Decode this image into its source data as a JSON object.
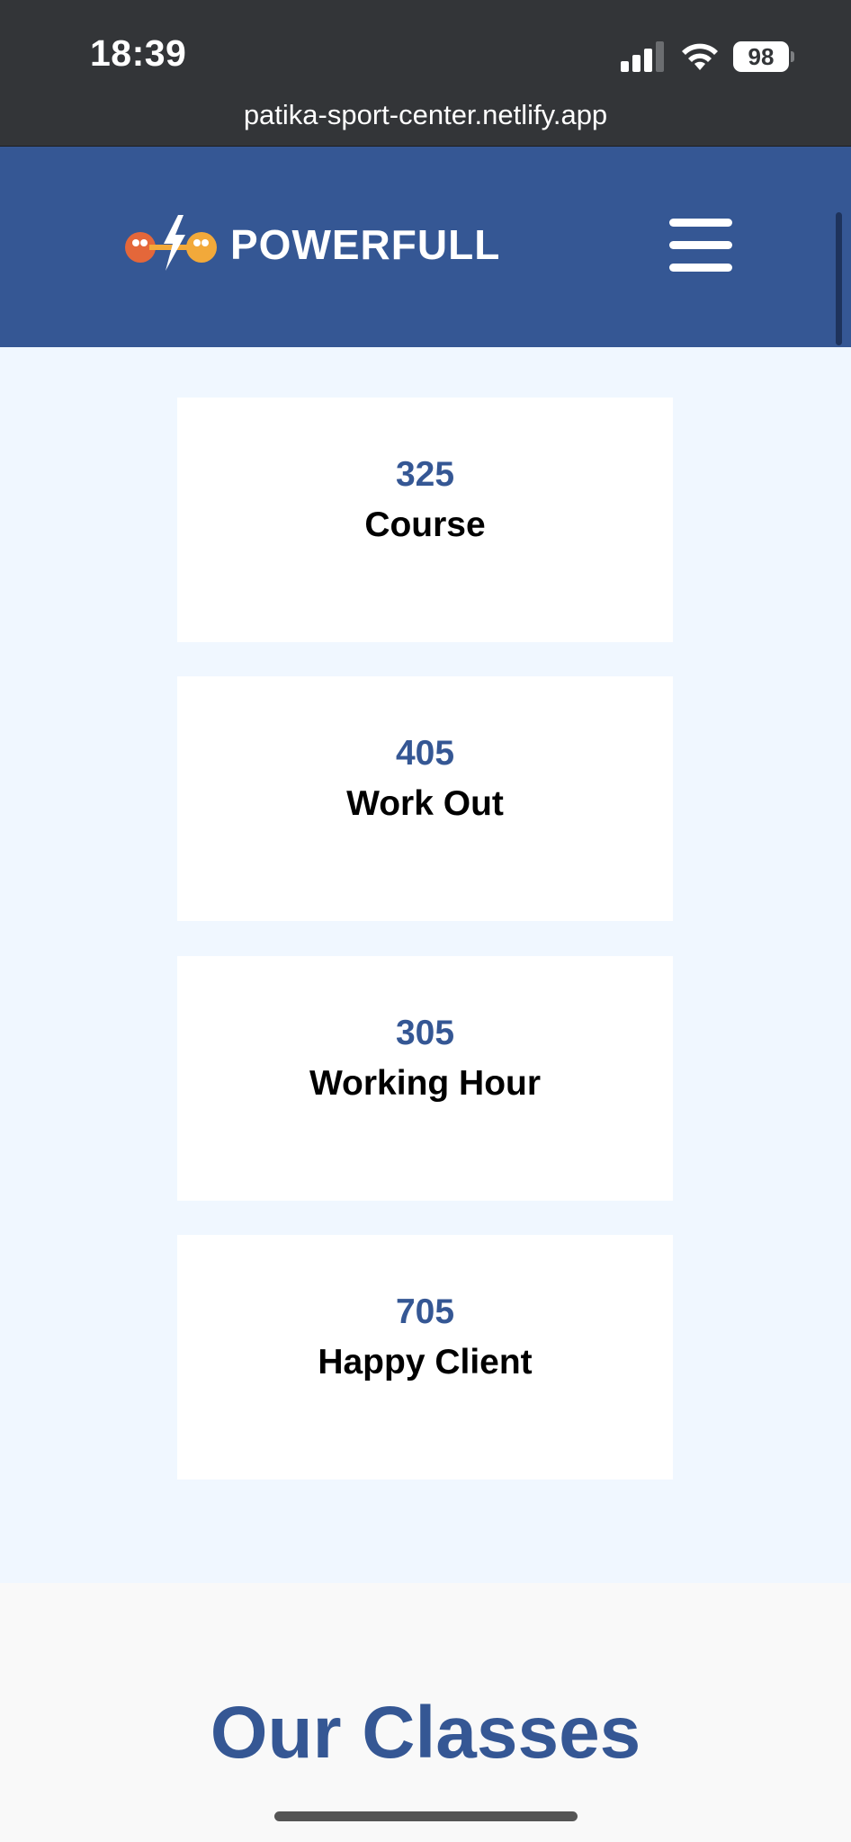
{
  "status_bar": {
    "time": "18:39",
    "battery": "98",
    "url": "patika-sport-center.netlify.app",
    "icons": [
      "signal-icon",
      "wifi-icon",
      "battery-icon"
    ]
  },
  "header": {
    "logo_text": "POWERFULL",
    "logo_icon": "dumbbell-lightning-icon",
    "menu_icon": "hamburger-menu-icon",
    "background_color": "#355794"
  },
  "stats": [
    {
      "number": "325",
      "label": "Course"
    },
    {
      "number": "405",
      "label": "Work Out"
    },
    {
      "number": "305",
      "label": "Working Hour"
    },
    {
      "number": "705",
      "label": "Happy Client"
    }
  ],
  "classes": {
    "title": "Our Classes"
  },
  "colors": {
    "brand_blue": "#355794",
    "stats_background": "#f0f7ff",
    "card_background": "#ffffff",
    "status_bar": "#333538"
  }
}
